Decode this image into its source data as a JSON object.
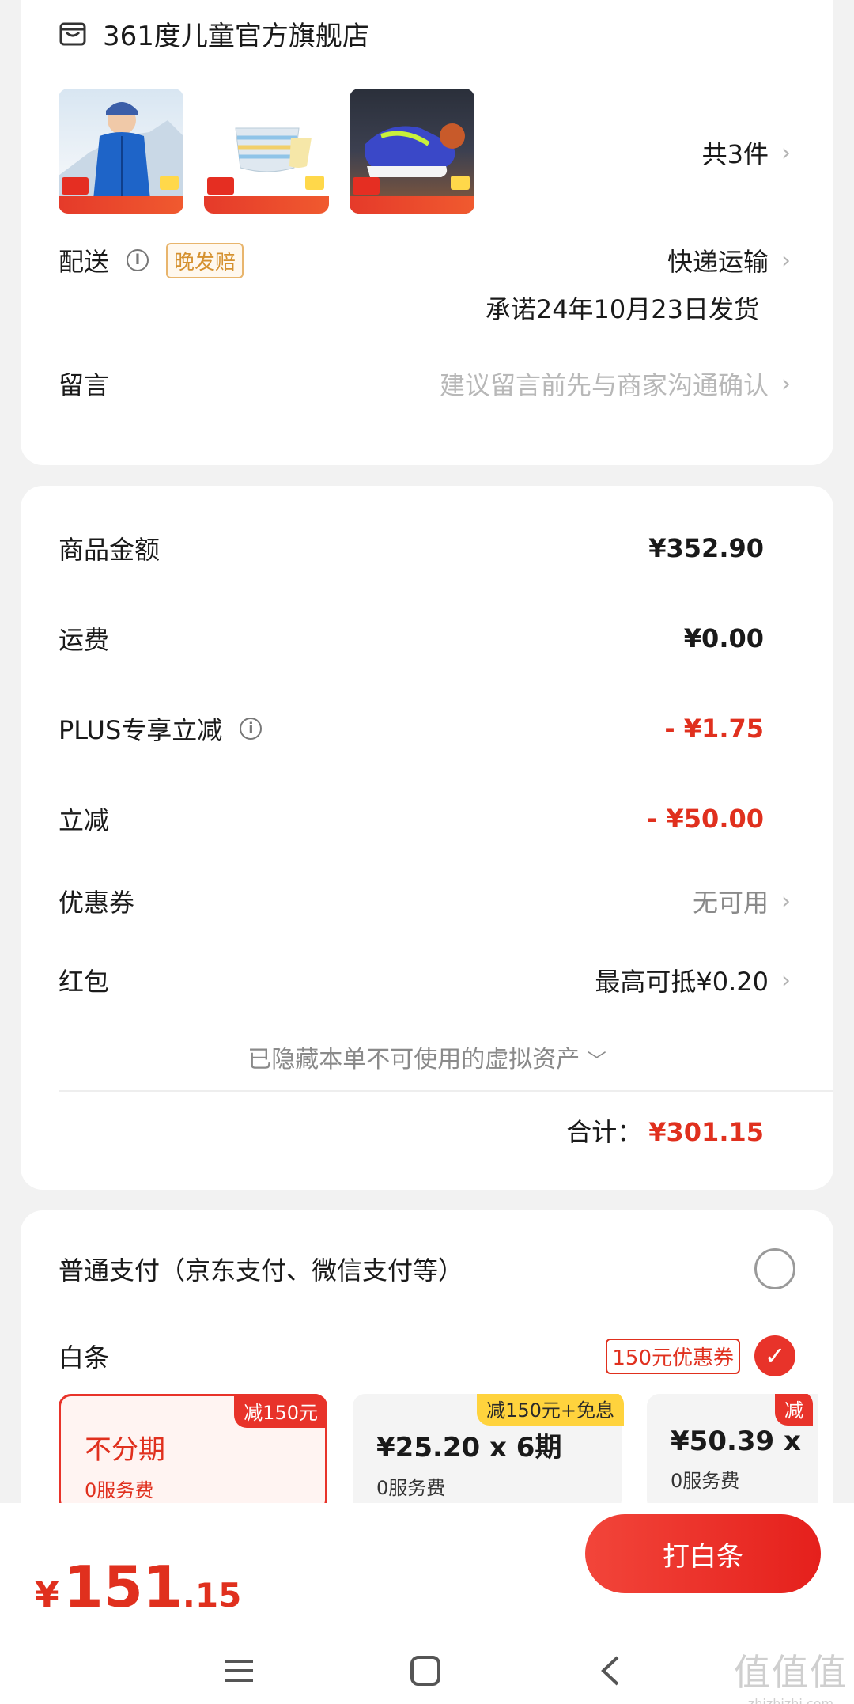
{
  "store": {
    "name": "361度儿童官方旗舰店",
    "item_count": "共3件",
    "products": [
      {
        "name": "jacket-thumbnail"
      },
      {
        "name": "underwear-thumbnail"
      },
      {
        "name": "sneaker-thumbnail"
      }
    ]
  },
  "delivery": {
    "label": "配送",
    "late_tag": "晚发赔",
    "method": "快递运输",
    "promise": "承诺24年10月23日发货"
  },
  "message": {
    "label": "留言",
    "placeholder": "建议留言前先与商家沟通确认"
  },
  "summary": {
    "goods_label": "商品金额",
    "goods_value": "¥352.90",
    "shipping_label": "运费",
    "shipping_value": "¥0.00",
    "plus_label": "PLUS专享立减",
    "plus_value": "- ¥1.75",
    "discount_label": "立减",
    "discount_value": "- ¥50.00",
    "coupon_label": "优惠券",
    "coupon_value": "无可用",
    "redpacket_label": "红包",
    "redpacket_value": "最高可抵¥0.20",
    "hidden_assets": "已隐藏本单不可使用的虚拟资产",
    "total_label": "合计：",
    "total_value": "¥301.15"
  },
  "payment": {
    "normal_label": "普通支付（京东支付、微信支付等）",
    "baitiao_label": "白条",
    "baitiao_coupon": "150元优惠券",
    "plans": [
      {
        "title": "不分期",
        "sub": "0服务费",
        "tag": "减150元"
      },
      {
        "title": "¥25.20 x 6期",
        "sub": "0服务费",
        "tag": "减150元+免息"
      },
      {
        "title": "¥50.39 x",
        "sub": "0服务费",
        "tag": "减"
      }
    ]
  },
  "bottom": {
    "currency": "¥",
    "price_int": "151",
    "price_dec": ".15",
    "pay_button": "打白条"
  },
  "watermark": {
    "chars": "值值值",
    "site": "zhizhizhi.com"
  },
  "colors": {
    "accent": "#e8332a",
    "price_red": "#e0301e",
    "tag_yellow": "#ffd33d"
  }
}
